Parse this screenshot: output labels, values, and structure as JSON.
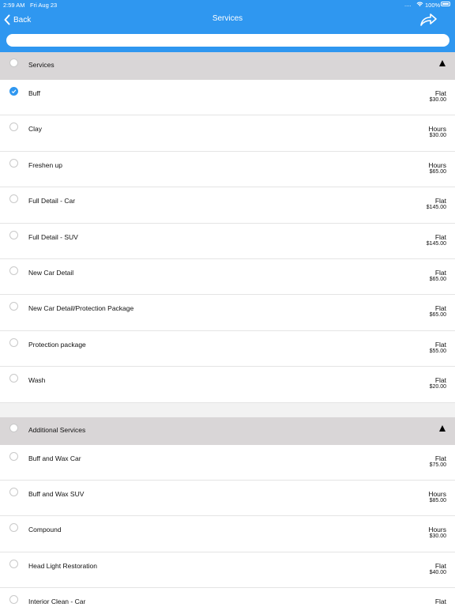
{
  "status_bar": {
    "time": "2:59 AM",
    "date": "Fri Aug 23",
    "dots": "....",
    "battery": "100%"
  },
  "nav": {
    "back_label": "Back",
    "title": "Services"
  },
  "search": {
    "placeholder": ""
  },
  "colors": {
    "accent": "#2f97f0",
    "section_bg": "#d9d6d7"
  },
  "sections": [
    {
      "title": "Services",
      "items": [
        {
          "name": "Buff",
          "rate_type": "Flat",
          "price": "$30.00",
          "checked": true
        },
        {
          "name": "Clay",
          "rate_type": "Hours",
          "price": "$30.00",
          "checked": false
        },
        {
          "name": "Freshen up",
          "rate_type": "Hours",
          "price": "$65.00",
          "checked": false
        },
        {
          "name": "Full Detail - Car",
          "rate_type": "Flat",
          "price": "$145.00",
          "checked": false
        },
        {
          "name": "Full Detail - SUV",
          "rate_type": "Flat",
          "price": "$145.00",
          "checked": false
        },
        {
          "name": "New Car Detail",
          "rate_type": "Flat",
          "price": "$65.00",
          "checked": false
        },
        {
          "name": "New Car Detail/Protection Package",
          "rate_type": "Flat",
          "price": "$65.00",
          "checked": false
        },
        {
          "name": "Protection package",
          "rate_type": "Flat",
          "price": "$55.00",
          "checked": false
        },
        {
          "name": "Wash",
          "rate_type": "Flat",
          "price": "$20.00",
          "checked": false
        }
      ]
    },
    {
      "title": "Additional Services",
      "items": [
        {
          "name": "Buff and Wax Car",
          "rate_type": "Flat",
          "price": "$75.00",
          "checked": false
        },
        {
          "name": "Buff and Wax SUV",
          "rate_type": "Hours",
          "price": "$85.00",
          "checked": false
        },
        {
          "name": "Compound",
          "rate_type": "Hours",
          "price": "$30.00",
          "checked": false
        },
        {
          "name": "Head Light Restoration",
          "rate_type": "Flat",
          "price": "$40.00",
          "checked": false
        },
        {
          "name": "Interior Clean - Car",
          "rate_type": "Flat",
          "price": "",
          "checked": false
        }
      ]
    }
  ]
}
